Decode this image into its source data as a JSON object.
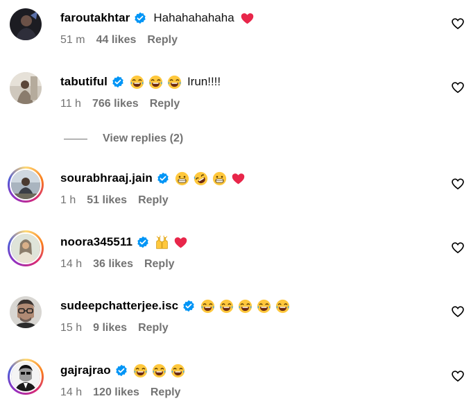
{
  "comments": [
    {
      "username": "faroutakhtar",
      "verified": true,
      "emojis_before": [],
      "text": "Hahahahahaha",
      "emojis_after": [
        "heart-emoji"
      ],
      "time": "51 m",
      "likes": "44 likes",
      "reply_label": "Reply",
      "avatar_ring": false
    },
    {
      "username": "tabutiful",
      "verified": true,
      "emojis_before": [
        "laughing-emoji",
        "laughing-emoji",
        "laughing-emoji"
      ],
      "text": "Irun!!!!",
      "emojis_after": [],
      "time": "11 h",
      "likes": "766 likes",
      "reply_label": "Reply",
      "avatar_ring": false,
      "view_replies": "View replies (2)"
    },
    {
      "username": "sourabhraaj.jain",
      "verified": true,
      "emojis_before": [
        "grin-emoji",
        "rofl-emoji",
        "grin-emoji",
        "heart-emoji"
      ],
      "text": "",
      "emojis_after": [],
      "time": "1 h",
      "likes": "51 likes",
      "reply_label": "Reply",
      "avatar_ring": true
    },
    {
      "username": "noora345511",
      "verified": true,
      "emojis_before": [
        "raised-hands-emoji",
        "heart-emoji"
      ],
      "text": "",
      "emojis_after": [],
      "time": "14 h",
      "likes": "36 likes",
      "reply_label": "Reply",
      "avatar_ring": true
    },
    {
      "username": "sudeepchatterjee.isc",
      "verified": true,
      "emojis_before": [
        "laughing-emoji",
        "laughing-emoji",
        "laughing-emoji",
        "laughing-emoji",
        "laughing-emoji"
      ],
      "text": "",
      "emojis_after": [],
      "time": "15 h",
      "likes": "9 likes",
      "reply_label": "Reply",
      "avatar_ring": false
    },
    {
      "username": "gajrajrao",
      "verified": true,
      "emojis_before": [
        "laughing-emoji",
        "laughing-emoji",
        "laughing-emoji"
      ],
      "text": "",
      "emojis_after": [],
      "time": "14 h",
      "likes": "120 likes",
      "reply_label": "Reply",
      "avatar_ring": true
    }
  ],
  "colors": {
    "verified_badge": "#0095f6",
    "meta_text": "#737373",
    "heart_emoji": "#e8264a",
    "story_ring": "#d62976"
  },
  "icons": {
    "like_button": "heart-outline-icon",
    "verified": "verified-badge-icon"
  }
}
